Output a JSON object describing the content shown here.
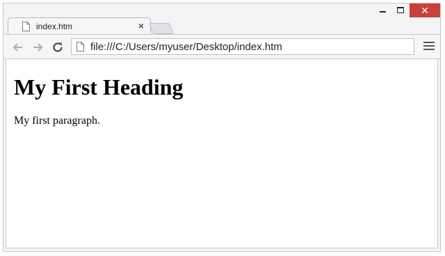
{
  "window": {
    "controls": {
      "minimize": "minimize",
      "maximize": "maximize",
      "close": "✕"
    }
  },
  "tab": {
    "title": "index.htm",
    "close_glyph": "×",
    "icon": "page-icon"
  },
  "toolbar": {
    "back_icon": "arrow-left-icon",
    "forward_icon": "arrow-right-icon",
    "reload_icon": "reload-icon",
    "menu_icon": "hamburger-menu-icon"
  },
  "omnibox": {
    "url": "file:///C:/Users/myuser/Desktop/index.htm",
    "icon": "page-icon"
  },
  "page": {
    "heading": "My First Heading",
    "paragraph": "My first paragraph."
  },
  "colors": {
    "close_button": "#c7403a",
    "chrome_bg": "#f6f6f6"
  }
}
